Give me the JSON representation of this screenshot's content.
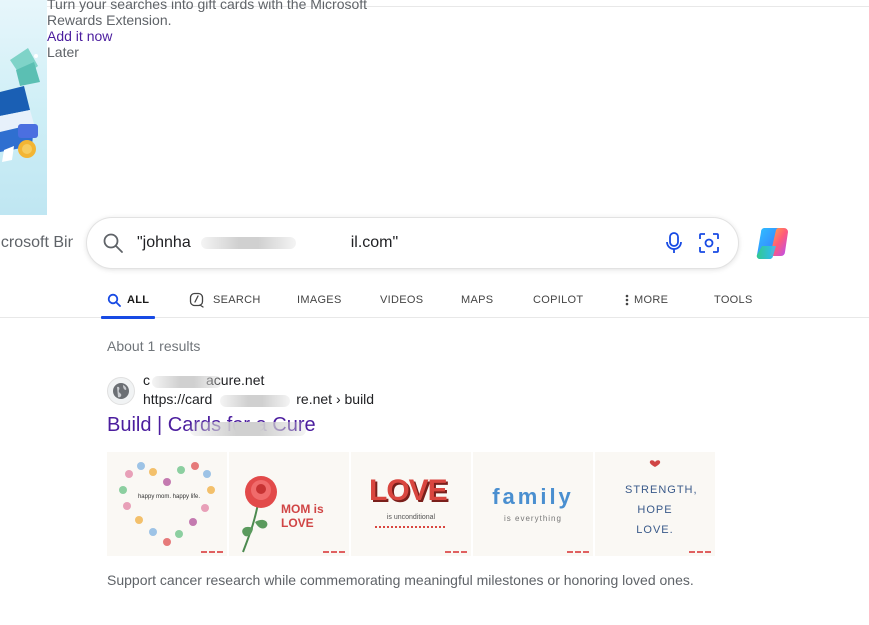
{
  "promo": {
    "line1": "Turn your searches into gift cards with the Microsoft",
    "line2": "Rewards Extension.",
    "cta": "Add it now",
    "dismiss": "Later"
  },
  "header": {
    "logo": "Microsoft Bing",
    "query": "\"johnha          il.com\""
  },
  "tabs": [
    {
      "label": "ALL",
      "icon": "search-icon",
      "active": true
    },
    {
      "label": "SEARCH",
      "icon": "copilot-search-icon",
      "active": false
    },
    {
      "label": "IMAGES",
      "active": false
    },
    {
      "label": "VIDEOS",
      "active": false
    },
    {
      "label": "MAPS",
      "active": false
    },
    {
      "label": "COPILOT",
      "active": false
    },
    {
      "label": "MORE",
      "icon": "kebab-icon",
      "active": false
    },
    {
      "label": "TOOLS",
      "active": false
    }
  ],
  "results": {
    "count": "About 1 results",
    "item": {
      "site": "c    acure.net",
      "url": "https://card      re.net › build",
      "title": "Build | Cards for a Cure",
      "snippet": "Support cancer research while commemorating meaningful milestones or honoring loved ones.",
      "images": [
        {
          "caption": "happy mom. happy life."
        },
        {
          "caption": "MOM is LOVE"
        },
        {
          "caption": "LOVE",
          "sub": "is unconditional"
        },
        {
          "caption": "family",
          "sub": "is everything"
        },
        {
          "caption": "STRENGTH, HOPE LOVE."
        }
      ]
    }
  },
  "colors": {
    "accent": "#174ae4",
    "link_visited": "#4b1d9e",
    "muted": "#70757a"
  }
}
